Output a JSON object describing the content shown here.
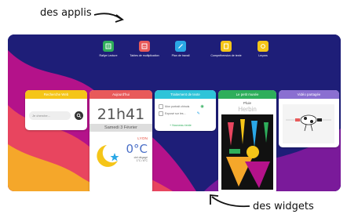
{
  "annotations": {
    "top": "des applis",
    "bottom": "des widgets"
  },
  "apps": [
    {
      "label": "Rallye Lecture",
      "color": "#2eae5b",
      "icon": "book-icon"
    },
    {
      "label": "Tables de multiplication",
      "color": "#e85a5a",
      "icon": "calculator-icon"
    },
    {
      "label": "Plan de travail",
      "color": "#2aa7e6",
      "icon": "pencil-icon"
    },
    {
      "label": "Compréhension de texte",
      "color": "#f5c518",
      "icon": "document-icon"
    },
    {
      "label": "Leçons",
      "color": "#f5c518",
      "icon": "lesson-icon"
    }
  ],
  "widgets": {
    "search": {
      "title": "Recherche Web",
      "color": "#f5c518",
      "placeholder": "Je cherche..."
    },
    "clock": {
      "title": "Aujourd'hui",
      "color": "#e85a5a",
      "time": "21h41",
      "date": "Samedi 3 Février",
      "city": "LYON",
      "temp": "0°C",
      "cond1": "ciel dégagé",
      "cond2": "1°C / 6°C"
    },
    "tasks": {
      "title": "Traitement de texte",
      "color": "#2ec4d9",
      "items": [
        "Mon portrait chinois",
        "Exposé sur les..."
      ],
      "add": "Nouveau texte"
    },
    "museum": {
      "title": "Le petit musée",
      "color": "#2eae5b",
      "artwork": "Pluie",
      "artist": "Herbin"
    },
    "video": {
      "title": "Vidéo partagée",
      "color": "#8a6fd1"
    }
  }
}
